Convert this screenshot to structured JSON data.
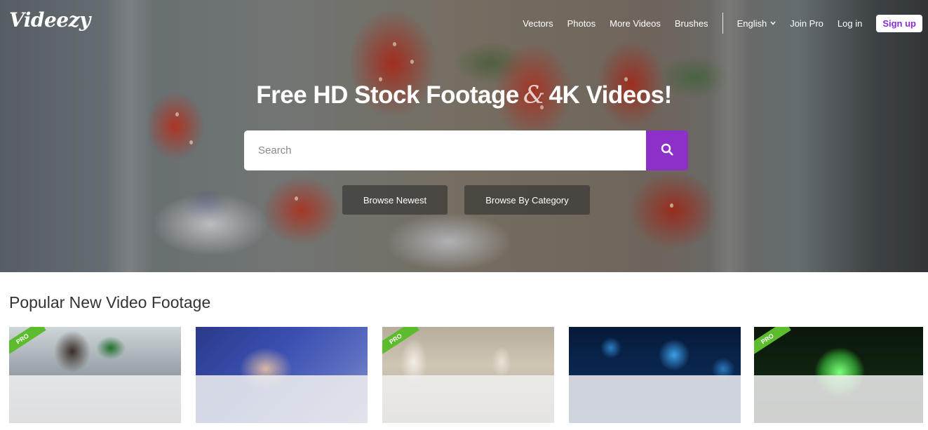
{
  "brand": {
    "logo_text": "Videezy"
  },
  "nav": {
    "links": [
      "Vectors",
      "Photos",
      "More Videos",
      "Brushes"
    ],
    "language": "English",
    "join_pro": "Join Pro",
    "log_in": "Log in",
    "sign_up": "Sign up"
  },
  "hero": {
    "title_part1": "Free HD Stock Footage",
    "title_amp": "&",
    "title_part2": "4K Videos!",
    "search_placeholder": "Search",
    "browse_newest": "Browse Newest",
    "browse_category": "Browse By Category"
  },
  "popular": {
    "title": "Popular New Video Footage",
    "pro_badge": "PRO",
    "thumbnails": [
      {
        "pro": true
      },
      {
        "pro": false
      },
      {
        "pro": true
      },
      {
        "pro": false
      },
      {
        "pro": true
      }
    ]
  },
  "colors": {
    "accent_purple": "#8d30c8",
    "signup_text": "#8e2ad6",
    "pro_green": "#5dbb2e"
  }
}
